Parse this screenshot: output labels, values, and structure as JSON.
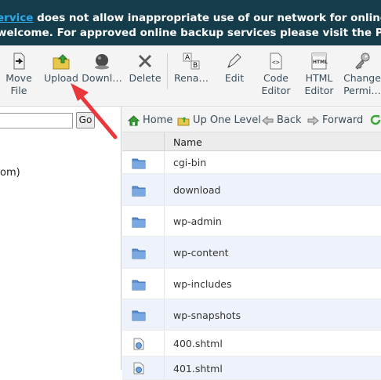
{
  "banner": {
    "line1_link": "ervice",
    "line1_rest": " does not allow inappropriate use of our network for online storage. Please",
    "line2": "welcome. For approved online backup services please visit the Partners section o"
  },
  "toolbar": {
    "items": [
      {
        "label": "Move\nFile",
        "icon": "move-file-icon"
      },
      {
        "label": "Upload",
        "icon": "upload-icon"
      },
      {
        "label": "Downl…",
        "icon": "download-icon"
      },
      {
        "label": "Delete",
        "icon": "delete-icon"
      },
      {
        "label": "Rena…",
        "icon": "rename-icon"
      },
      {
        "label": "Edit",
        "icon": "edit-icon"
      },
      {
        "label": "Code\nEditor",
        "icon": "code-editor-icon"
      },
      {
        "label": "HTML\nEditor",
        "icon": "html-editor-icon"
      },
      {
        "label": "Change\nPermi…",
        "icon": "change-permissions-icon"
      }
    ]
  },
  "left": {
    "go_label": "Go",
    "tree_text": "om)"
  },
  "nav": {
    "home": "Home",
    "up_one_level": "Up One Level",
    "back": "Back",
    "forward": "Forward"
  },
  "table": {
    "header_name": "Name",
    "rows": [
      {
        "name": "cgi-bin",
        "type": "folder"
      },
      {
        "name": "download",
        "type": "folder"
      },
      {
        "name": "wp-admin",
        "type": "folder"
      },
      {
        "name": "wp-content",
        "type": "folder"
      },
      {
        "name": "wp-includes",
        "type": "folder"
      },
      {
        "name": "wp-snapshots",
        "type": "folder"
      },
      {
        "name": "400.shtml",
        "type": "file"
      },
      {
        "name": "401.shtml",
        "type": "file"
      }
    ]
  },
  "colors": {
    "banner_bg": "#143c4a",
    "link": "#2fa8e8",
    "folder": "#5b8fd1",
    "arrow": "#e8383b",
    "alt_row": "#eef3fb"
  }
}
